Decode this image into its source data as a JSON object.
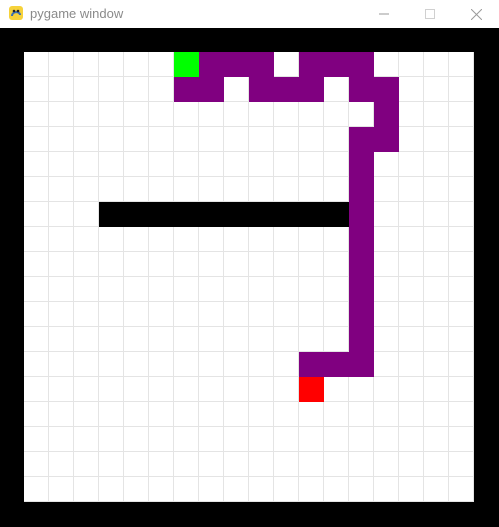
{
  "window": {
    "title": "pygame window",
    "icon": "pygame-snake-icon",
    "controls": [
      "minimize-icon",
      "maximize-icon",
      "close-icon"
    ]
  },
  "game": {
    "grid": {
      "cols": 18,
      "rows": 18
    },
    "colors": {
      "border": "#000000",
      "background": "#ffffff",
      "gridline": "#e4e4e4",
      "snake": "#800080",
      "head": "#00ff00",
      "food": "#ff0000",
      "obstacle": "#000000"
    },
    "snake_head": {
      "col": 6,
      "row": 0
    },
    "snake_body": [
      [
        7,
        0
      ],
      [
        8,
        0
      ],
      [
        9,
        0
      ],
      [
        11,
        0
      ],
      [
        12,
        0
      ],
      [
        13,
        0
      ],
      [
        6,
        1
      ],
      [
        7,
        1
      ],
      [
        9,
        1
      ],
      [
        10,
        1
      ],
      [
        11,
        1
      ],
      [
        13,
        1
      ],
      [
        14,
        1
      ],
      [
        14,
        2
      ],
      [
        13,
        3
      ],
      [
        14,
        3
      ],
      [
        13,
        4
      ],
      [
        13,
        5
      ],
      [
        13,
        6
      ],
      [
        13,
        7
      ],
      [
        13,
        8
      ],
      [
        13,
        9
      ],
      [
        13,
        10
      ],
      [
        13,
        11
      ],
      [
        11,
        12
      ],
      [
        12,
        12
      ],
      [
        13,
        12
      ]
    ],
    "food": {
      "col": 11,
      "row": 13
    },
    "obstacle": {
      "col_start": 3,
      "col_end": 12,
      "row": 6
    }
  }
}
